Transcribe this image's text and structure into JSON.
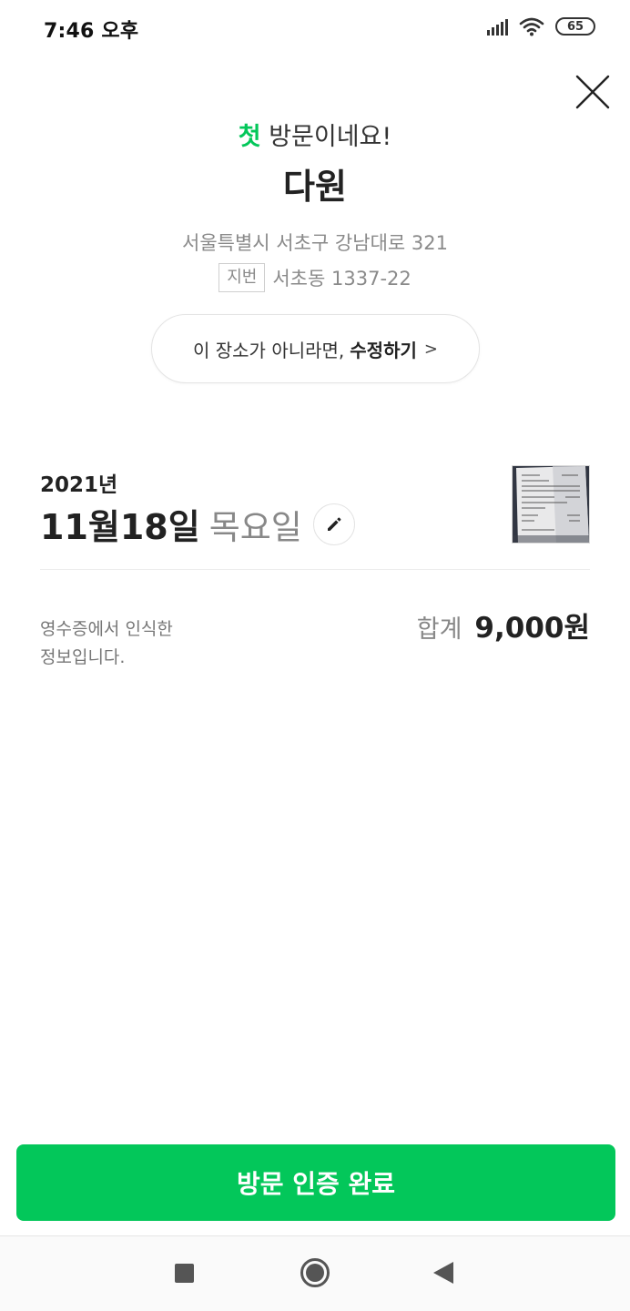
{
  "status_bar": {
    "time": "7:46 오후",
    "battery": "65",
    "icons": [
      "signal-icon",
      "wifi-icon",
      "battery-icon"
    ]
  },
  "header": {
    "visit_accent": "첫",
    "visit_rest": " 방문이네요!",
    "place_name": "다원",
    "road_address": "서울특별시 서초구 강남대로 321",
    "jibun_label": "지번",
    "jibun_address": "서초동 1337-22",
    "edit_place_prefix": "이 장소가 아니라면,",
    "edit_place_action": "수정하기",
    "edit_place_chevron": ">"
  },
  "visit": {
    "year": "2021년",
    "date": "11월18일",
    "weekday": "목요일"
  },
  "receipt": {
    "ocr_note_line1": "영수증에서 인식한",
    "ocr_note_line2": "정보입니다.",
    "total_label": "합계",
    "total_value": "9,000원"
  },
  "cta": {
    "label": "방문 인증 완료"
  },
  "colors": {
    "accent": "#03c75a",
    "text_primary": "#222222",
    "text_secondary": "#888888"
  }
}
